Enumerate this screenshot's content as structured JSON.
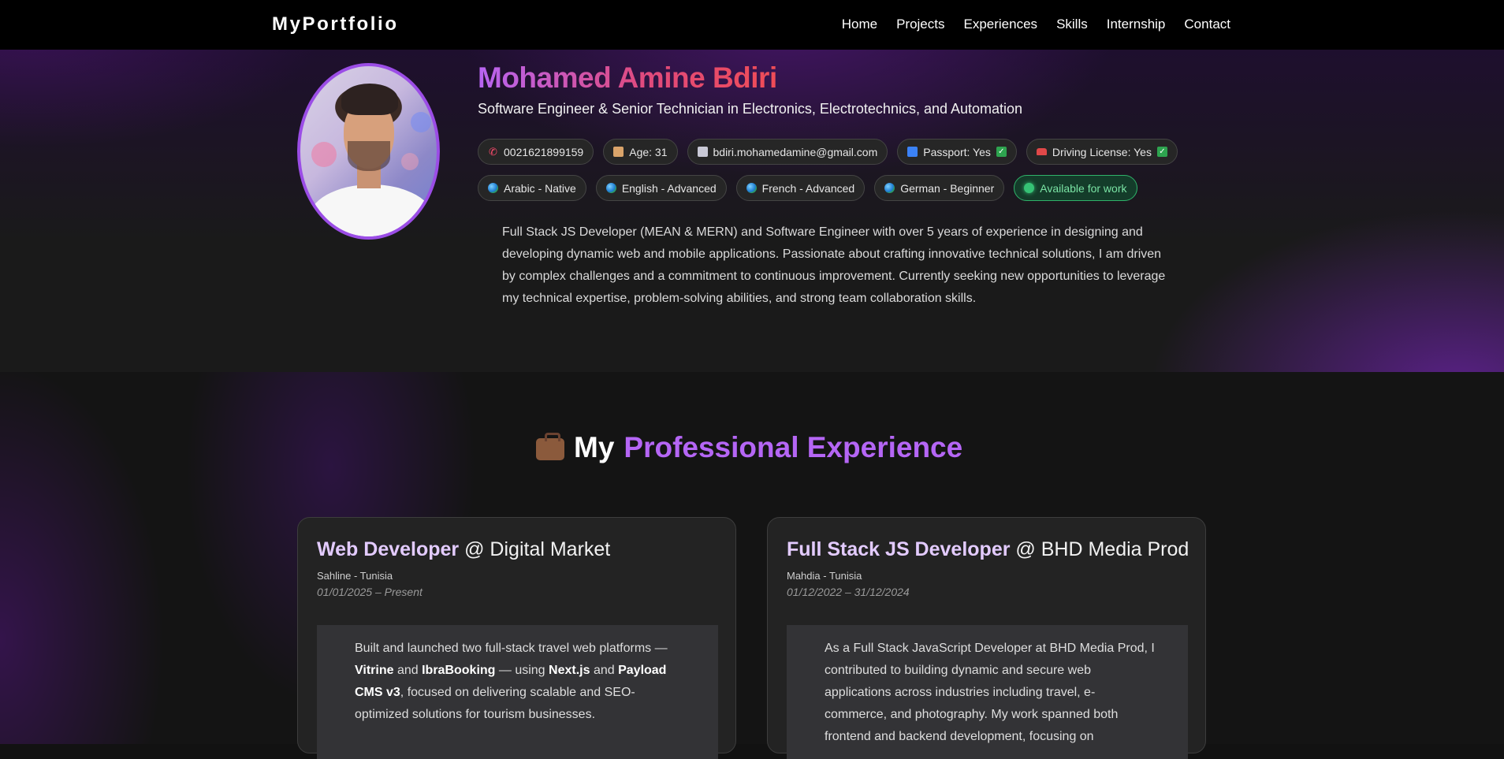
{
  "nav": {
    "brand": "MyPortfolio",
    "links": [
      "Home",
      "Projects",
      "Experiences",
      "Skills",
      "Internship",
      "Contact"
    ]
  },
  "hero": {
    "name": "Mohamed Amine Bdiri",
    "subtitle": "Software Engineer & Senior Technician in Electronics, Electrotechnics, and Automation",
    "info_pills": {
      "phone": "0021621899159",
      "age": "Age: 31",
      "email": "bdiri.mohamedamine@gmail.com",
      "passport": "Passport: Yes",
      "license": "Driving License: Yes"
    },
    "languages": [
      "Arabic - Native",
      "English - Advanced",
      "French - Advanced",
      "German - Beginner"
    ],
    "availability": "Available for work",
    "bio": "Full Stack JS Developer (MEAN & MERN) and Software Engineer with over 5 years of experience in designing and developing dynamic web and mobile applications. Passionate about crafting innovative technical solutions, I am driven by complex challenges and a commitment to continuous improvement. Currently seeking new opportunities to leverage my technical expertise, problem-solving abilities, and strong team collaboration skills."
  },
  "experience": {
    "title_prefix": "My",
    "title_highlight": "Professional Experience",
    "cards": [
      {
        "role": "Web Developer",
        "company": "@ Digital Market",
        "location": "Sahline - Tunisia",
        "dates": "01/01/2025 – Present",
        "body": {
          "t1": "Built and launched two full-stack travel web platforms — ",
          "b1": "Vitrine",
          "t2": " and ",
          "b2": "IbraBooking",
          "t3": " — using ",
          "b3": "Next.js",
          "t4": " and ",
          "b4": "Payload CMS v3",
          "t5": ", focused on delivering scalable and SEO-optimized solutions for tourism businesses."
        }
      },
      {
        "role": "Full Stack JS Developer",
        "company": "@ BHD Media Prod",
        "location": "Mahdia - Tunisia",
        "dates": "01/12/2022 – 31/12/2024",
        "body_text": "As a Full Stack JavaScript Developer at BHD Media Prod, I contributed to building dynamic and secure web applications across industries including travel, e-commerce, and photography. My work spanned both frontend and backend development, focusing on"
      }
    ]
  }
}
